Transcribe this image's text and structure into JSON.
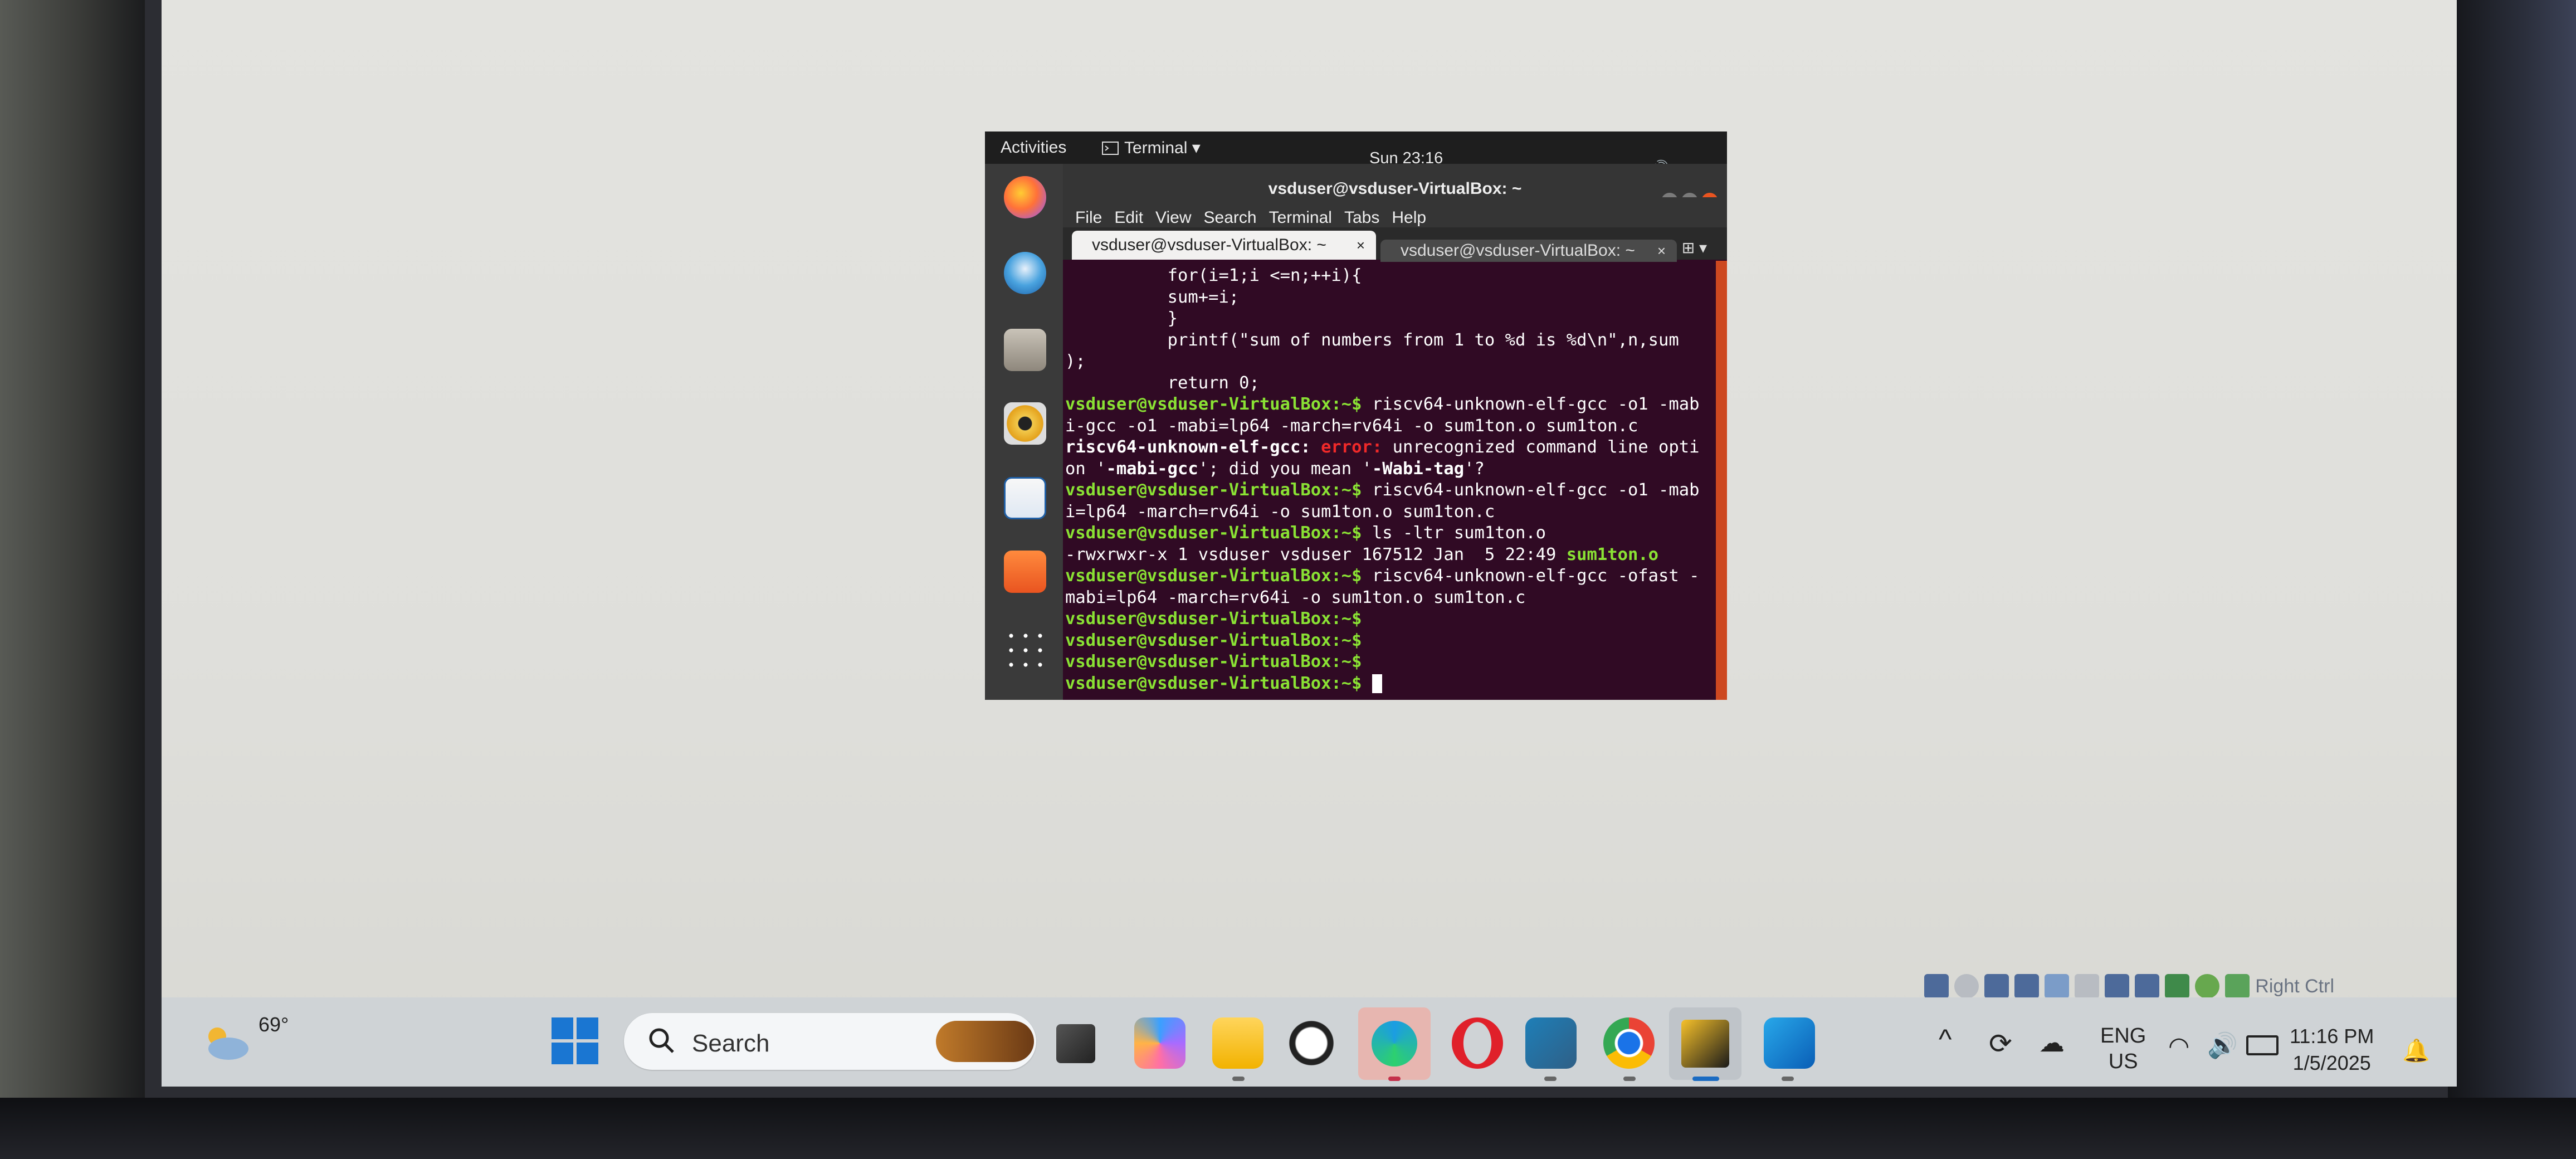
{
  "vm": {
    "activities": "Activities",
    "app_menu": "Terminal ▾",
    "clock": "Sun 23:16",
    "window_title": "vsduser@vsduser-VirtualBox: ~",
    "menu": [
      "File",
      "Edit",
      "View",
      "Search",
      "Terminal",
      "Tabs",
      "Help"
    ],
    "tabs": [
      {
        "label": "vsduser@vsduser-VirtualBox: ~",
        "active": true
      },
      {
        "label": "vsduser@vsduser-VirtualBox: ~",
        "active": false
      }
    ],
    "dock_icons": [
      "firefox-icon",
      "thunderbird-icon",
      "files-icon",
      "rhythmbox-icon",
      "writer-icon",
      "software-icon",
      "app-grid-icon"
    ]
  },
  "terminal": {
    "code_lines": [
      "          for(i=1;i <=n;++i){",
      "          sum+=i;",
      "          }",
      "          printf(\"sum of numbers from 1 to %d is %d\\n\",n,sum",
      ");",
      "          return 0;"
    ],
    "prompt": "vsduser@vsduser-VirtualBox:~$",
    "cmd1_a": " riscv64-unknown-elf-gcc -o1 -mab",
    "cmd1_b": "i-gcc -o1 -mabi=lp64 -march=rv64i -o sum1ton.o sum1ton.c",
    "err_prefix": "riscv64-unknown-elf-gcc:",
    "err_word": " error:",
    "err_text_a": " unrecognized command line opti",
    "err_text_b1": "on '",
    "err_opt": "-mabi-gcc",
    "err_text_b2": "'; did you mean '",
    "err_sugg": "-Wabi-tag",
    "err_text_b3": "'?",
    "cmd2_a": " riscv64-unknown-elf-gcc -o1 -mab",
    "cmd2_b": "i=lp64 -march=rv64i -o sum1ton.o sum1ton.c",
    "cmd3": " ls -ltr sum1ton.o",
    "ls_out": "-rwxrwxr-x 1 vsduser vsduser 167512 Jan  5 22:49 ",
    "ls_file": "sum1ton.o",
    "cmd4_a": " riscv64-unknown-elf-gcc -ofast -",
    "cmd4_b": "mabi=lp64 -march=rv64i -o sum1ton.o sum1ton.c"
  },
  "host": {
    "weather_temp": "69°",
    "search_label": "Search",
    "lang_top": "ENG",
    "lang_bottom": "US",
    "time": "11:16 PM",
    "date": "1/5/2025",
    "right_ctrl": "Right Ctrl",
    "taskbar_apps": [
      "start-icon",
      "task-view-icon",
      "copilot-icon",
      "file-explorer-icon",
      "whatsapp-icon",
      "edge-icon",
      "opera-icon",
      "vs-code-icon",
      "chrome-icon",
      "virtualbox-icon",
      "outlook-icon"
    ]
  }
}
